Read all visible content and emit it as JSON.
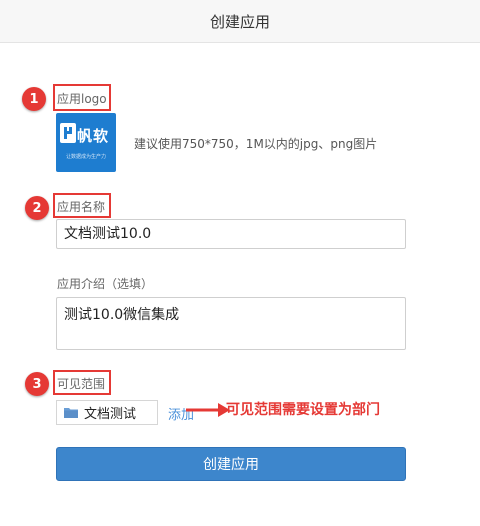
{
  "header": {
    "title": "创建应用"
  },
  "steps": [
    "1",
    "2",
    "3"
  ],
  "logo_section": {
    "label": "应用logo",
    "logo_text": "帆软",
    "logo_tagline": "让数据成为生产力",
    "hint": "建议使用750*750，1M以内的jpg、png图片"
  },
  "name_section": {
    "label": "应用名称",
    "value": "文档测试10.0"
  },
  "intro_section": {
    "label": "应用介绍（选填）",
    "value": "测试10.0微信集成"
  },
  "scope_section": {
    "label": "可见范围",
    "department": "文档测试",
    "add_label": "添加",
    "annotation": "可见范围需要设置为部门"
  },
  "submit": {
    "label": "创建应用"
  },
  "colors": {
    "accent": "#3d86cc",
    "annotation_red": "#e53935",
    "logo_blue": "#1e7dd0"
  }
}
